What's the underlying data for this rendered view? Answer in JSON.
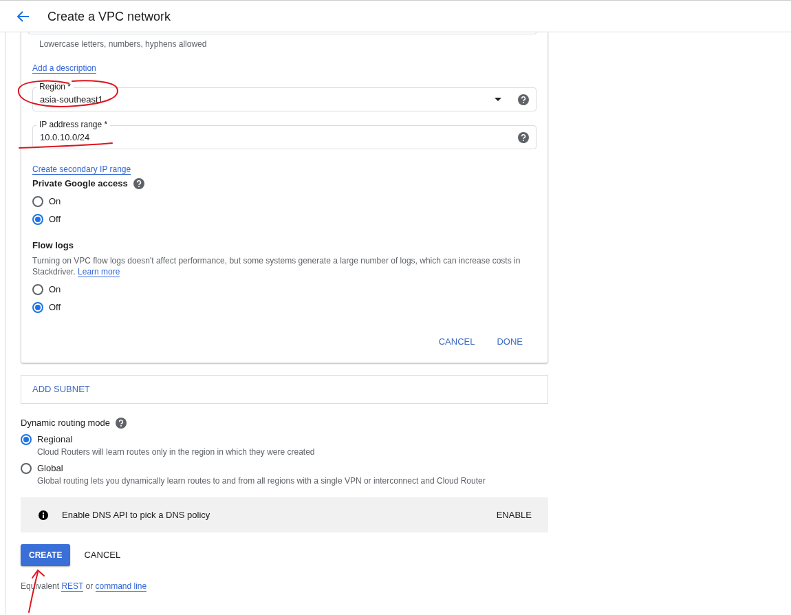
{
  "header": {
    "title": "Create a VPC network"
  },
  "subnet_card": {
    "name_hint": "Lowercase letters, numbers, hyphens allowed",
    "add_description": "Add a description",
    "region": {
      "label": "Region *",
      "value": "asia-southeast1"
    },
    "ip_range": {
      "label": "IP address range *",
      "value": "10.0.10.0/24"
    },
    "secondary_link": "Create secondary IP range",
    "private_access": {
      "label": "Private Google access",
      "options": [
        {
          "label": "On",
          "selected": false
        },
        {
          "label": "Off",
          "selected": true
        }
      ]
    },
    "flow_logs": {
      "label": "Flow logs",
      "description": "Turning on VPC flow logs doesn't affect performance, but some systems generate a large number of logs, which can increase costs in Stackdriver.",
      "learn_more": "Learn more",
      "options": [
        {
          "label": "On",
          "selected": false
        },
        {
          "label": "Off",
          "selected": true
        }
      ]
    },
    "buttons": [
      "CANCEL",
      "DONE"
    ]
  },
  "add_subnet": "ADD SUBNET",
  "routing": {
    "label": "Dynamic routing mode",
    "options": [
      {
        "label": "Regional",
        "description": "Cloud Routers will learn routes only in the region in which they were created",
        "selected": true
      },
      {
        "label": "Global",
        "description": "Global routing lets you dynamically learn routes to and from all regions with a single VPN or interconnect and Cloud Router",
        "selected": false
      }
    ]
  },
  "dns_banner": {
    "text": "Enable DNS API to pick a DNS policy",
    "action": "ENABLE"
  },
  "actions": {
    "create": "CREATE",
    "cancel": "CANCEL"
  },
  "footer": {
    "prefix": "Equivalent",
    "rest": "REST",
    "middle": "or",
    "command_line": "command line"
  },
  "annotations": [
    {
      "kind": "circle"
    },
    {
      "kind": "underline"
    },
    {
      "kind": "arrow"
    }
  ]
}
